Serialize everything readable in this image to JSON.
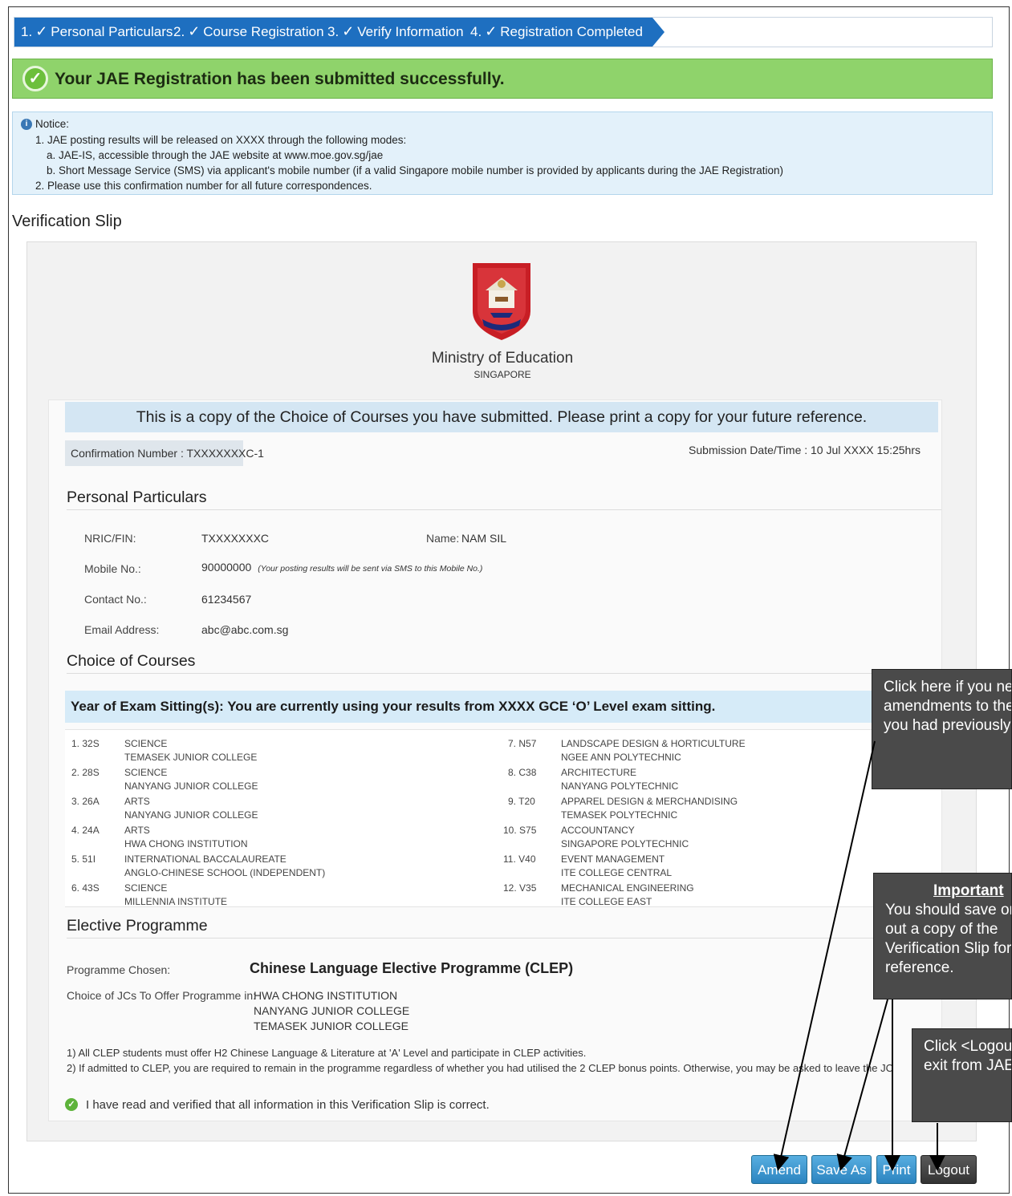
{
  "steps": [
    {
      "num": "1.",
      "label": "Personal Particulars"
    },
    {
      "num": "2.",
      "label": "Course Registration"
    },
    {
      "num": "3.",
      "label": "Verify Information"
    },
    {
      "num": "4.",
      "label": "Registration Completed"
    }
  ],
  "success": {
    "message": "Your JAE Registration has been submitted successfully."
  },
  "notice": {
    "title": "Notice:",
    "line1": "1. JAE posting results will be released on XXXX through the following modes:",
    "line1a": "a. JAE-IS, accessible through the JAE website at www.moe.gov.sg/jae",
    "line1b": "b. Short Message Service (SMS) via applicant's mobile number (if a valid Singapore mobile number is provided by applicants during the JAE Registration)",
    "line2": "2. Please use this confirmation number for all future correspondences."
  },
  "slip": {
    "title": "Verification Slip",
    "ministry": "Ministry of Education",
    "ministry_sub": "SINGAPORE",
    "copy_notice": "This is a copy of the Choice of Courses you have submitted. Please print a copy for your future reference.",
    "confirmation": "Confirmation Number : TXXXXXXXC-1",
    "submission": "Submission Date/Time : 10 Jul XXXX 15:25hrs"
  },
  "personal": {
    "heading": "Personal Particulars",
    "nric_label": "NRIC/FIN:",
    "nric": "TXXXXXXXC",
    "name_label": "Name:",
    "name": "NAM SIL",
    "mobile_label": "Mobile No.:",
    "mobile": "90000000",
    "mobile_note": "(Your posting results will be sent via SMS to this Mobile No.)",
    "contact_label": "Contact No.:",
    "contact": "61234567",
    "email_label": "Email Address:",
    "email": "abc@abc.com.sg"
  },
  "courses": {
    "heading": "Choice of Courses",
    "year_banner": "Year of Exam Sitting(s): You are currently using your results from XXXX GCE ‘O’ Level exam sitting.",
    "left": [
      {
        "num": "1.",
        "code": "32S",
        "course": "SCIENCE",
        "school": "TEMASEK JUNIOR COLLEGE"
      },
      {
        "num": "2.",
        "code": "28S",
        "course": "SCIENCE",
        "school": "NANYANG JUNIOR COLLEGE"
      },
      {
        "num": "3.",
        "code": "26A",
        "course": "ARTS",
        "school": "NANYANG JUNIOR COLLEGE"
      },
      {
        "num": "4.",
        "code": "24A",
        "course": "ARTS",
        "school": "HWA CHONG INSTITUTION"
      },
      {
        "num": "5.",
        "code": "51I",
        "course": "INTERNATIONAL BACCALAUREATE",
        "school": "ANGLO-CHINESE SCHOOL (INDEPENDENT)"
      },
      {
        "num": "6.",
        "code": "43S",
        "course": "SCIENCE",
        "school": "MILLENNIA INSTITUTE"
      }
    ],
    "right": [
      {
        "num": "7.",
        "code": "N57",
        "course": "LANDSCAPE DESIGN & HORTICULTURE",
        "school": "NGEE ANN POLYTECHNIC"
      },
      {
        "num": "8.",
        "code": "C38",
        "course": "ARCHITECTURE",
        "school": "NANYANG POLYTECHNIC"
      },
      {
        "num": "9.",
        "code": "T20",
        "course": "APPAREL DESIGN & MERCHANDISING",
        "school": "TEMASEK POLYTECHNIC"
      },
      {
        "num": "10.",
        "code": "S75",
        "course": "ACCOUNTANCY",
        "school": "SINGAPORE POLYTECHNIC"
      },
      {
        "num": "11.",
        "code": "V40",
        "course": "EVENT MANAGEMENT",
        "school": "ITE COLLEGE CENTRAL"
      },
      {
        "num": "12.",
        "code": "V35",
        "course": "MECHANICAL ENGINEERING",
        "school": "ITE COLLEGE EAST"
      }
    ]
  },
  "elective": {
    "heading": "Elective Programme",
    "prog_label": "Programme Chosen:",
    "prog_value": "Chinese Language Elective Programme (CLEP)",
    "jc_label": "Choice of JCs To Offer Programme in:",
    "jcs": [
      "HWA CHONG INSTITUTION",
      "NANYANG JUNIOR COLLEGE",
      "TEMASEK JUNIOR COLLEGE"
    ],
    "rule1": "1) All CLEP students must offer H2 Chinese Language & Literature at 'A' Level and participate in CLEP activities.",
    "rule2": "2) If admitted to CLEP, you are required to remain in the programme regardless of whether you had utilised the 2 CLEP bonus points. Otherwise, you may be asked to leave the JC"
  },
  "verify_text": "I have read and verified that all information in this Verification Slip is correct.",
  "buttons": {
    "amend": "Amend",
    "save_as": "Save As",
    "print": "Print",
    "logout": "Logout"
  },
  "callouts": {
    "amend": "Click here if you need to make amendments to the application you had previously submitted.",
    "important_title": "Important",
    "important": "You should save or print out a copy of the Verification Slip for your reference.",
    "logout": "Click <Logout> to exit from JAE-IS."
  }
}
